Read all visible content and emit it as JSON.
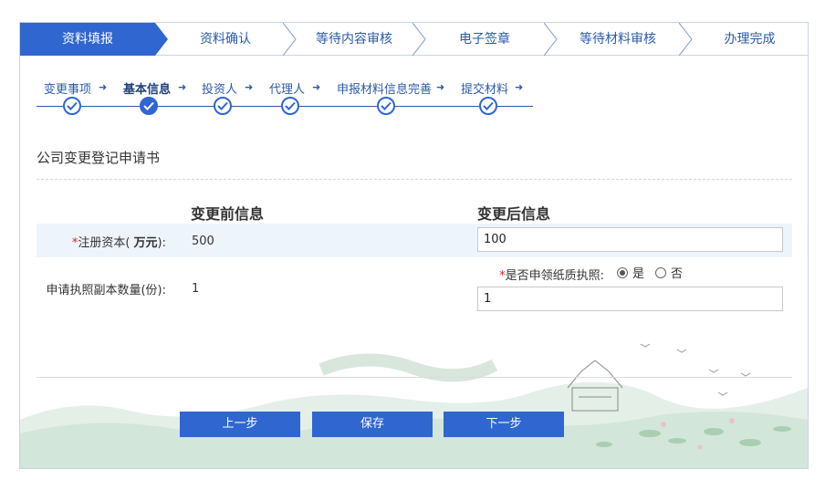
{
  "process_steps": [
    "资料填报",
    "资料确认",
    "等待内容审核",
    "电子签章",
    "等待材料审核",
    "办理完成"
  ],
  "sub_steps": [
    "变更事项",
    "基本信息",
    "投资人",
    "代理人",
    "申报材料信息完善",
    "提交材料"
  ],
  "form": {
    "title": "公司变更登记申请书",
    "before_header": "变更前信息",
    "after_header": "变更后信息",
    "registered_capital": {
      "required_mark": "*",
      "label_prefix": "注册资本(",
      "label_unit": "万元",
      "label_suffix": "):",
      "before": "500",
      "after": "100"
    },
    "license_copies": {
      "label": "申请执照副本数量(份):",
      "before": "1",
      "after": "1"
    },
    "paper_license": {
      "required_mark": "*",
      "label": "是否申领纸质执照:",
      "option_yes": "是",
      "option_no": "否",
      "selected": "是"
    }
  },
  "buttons": {
    "prev": "上一步",
    "save": "保存",
    "next": "下一步"
  },
  "colors": {
    "primary": "#2f66d0",
    "link": "#2a5aa8",
    "required": "#e02020",
    "row_highlight": "#eef4fc"
  }
}
